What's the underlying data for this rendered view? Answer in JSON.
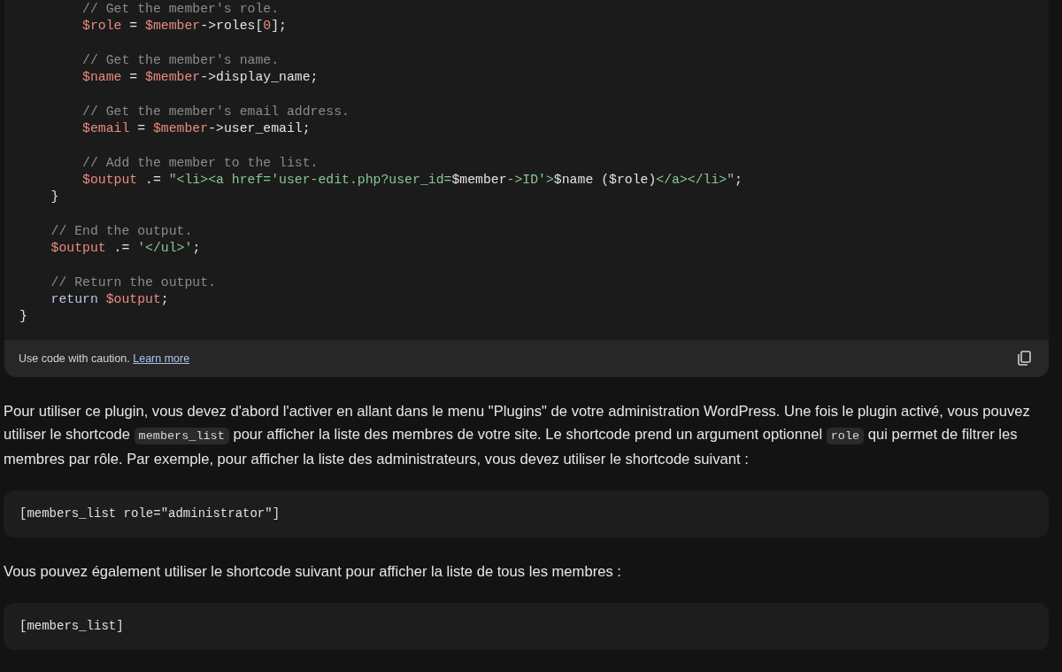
{
  "code_block": {
    "lines": [
      {
        "kind": "code",
        "tokens": [
          {
            "kind": "comment",
            "text": "        // Get the member's role."
          }
        ]
      },
      {
        "kind": "code",
        "tokens": [
          {
            "kind": "variable",
            "text": "        $role"
          },
          {
            "kind": "plain",
            "text": " = "
          },
          {
            "kind": "variable",
            "text": "$member"
          },
          {
            "kind": "plain",
            "text": "->roles["
          },
          {
            "kind": "number",
            "text": "0"
          },
          {
            "kind": "plain",
            "text": "];"
          }
        ]
      },
      {
        "kind": "blank"
      },
      {
        "kind": "code",
        "tokens": [
          {
            "kind": "comment",
            "text": "        // Get the member's name."
          }
        ]
      },
      {
        "kind": "code",
        "tokens": [
          {
            "kind": "variable",
            "text": "        $name"
          },
          {
            "kind": "plain",
            "text": " = "
          },
          {
            "kind": "variable",
            "text": "$member"
          },
          {
            "kind": "plain",
            "text": "->display_name;"
          }
        ]
      },
      {
        "kind": "blank"
      },
      {
        "kind": "code",
        "tokens": [
          {
            "kind": "comment",
            "text": "        // Get the member's email address."
          }
        ]
      },
      {
        "kind": "code",
        "tokens": [
          {
            "kind": "variable",
            "text": "        $email"
          },
          {
            "kind": "plain",
            "text": " = "
          },
          {
            "kind": "variable",
            "text": "$member"
          },
          {
            "kind": "plain",
            "text": "->user_email;"
          }
        ]
      },
      {
        "kind": "blank"
      },
      {
        "kind": "code",
        "tokens": [
          {
            "kind": "comment",
            "text": "        // Add the member to the list."
          }
        ]
      },
      {
        "kind": "code",
        "tokens": [
          {
            "kind": "variable",
            "text": "        $output"
          },
          {
            "kind": "plain",
            "text": " .= "
          },
          {
            "kind": "string",
            "text": "\"<li><a href='user-edit.php?user_id="
          },
          {
            "kind": "plain",
            "text": "$member"
          },
          {
            "kind": "string",
            "text": "->ID'>"
          },
          {
            "kind": "plain",
            "text": "$name ($role)"
          },
          {
            "kind": "string",
            "text": "</a></li>\""
          },
          {
            "kind": "plain",
            "text": ";"
          }
        ]
      },
      {
        "kind": "code",
        "tokens": [
          {
            "kind": "plain",
            "text": "    }"
          }
        ]
      },
      {
        "kind": "blank"
      },
      {
        "kind": "code",
        "tokens": [
          {
            "kind": "comment",
            "text": "    // End the output."
          }
        ]
      },
      {
        "kind": "code",
        "tokens": [
          {
            "kind": "variable",
            "text": "    $output"
          },
          {
            "kind": "plain",
            "text": " .= "
          },
          {
            "kind": "string",
            "text": "'</ul>'"
          },
          {
            "kind": "plain",
            "text": ";"
          }
        ]
      },
      {
        "kind": "blank"
      },
      {
        "kind": "code",
        "tokens": [
          {
            "kind": "comment",
            "text": "    // Return the output."
          }
        ]
      },
      {
        "kind": "code",
        "tokens": [
          {
            "kind": "keyword",
            "text": "    return "
          },
          {
            "kind": "variable",
            "text": "$output"
          },
          {
            "kind": "plain",
            "text": ";"
          }
        ]
      },
      {
        "kind": "code",
        "tokens": [
          {
            "kind": "plain",
            "text": "}"
          }
        ]
      }
    ],
    "footer": {
      "notice": "Use code with caution.",
      "link": "Learn more"
    }
  },
  "content": [
    {
      "kind": "paragraph",
      "segments": [
        {
          "kind": "text",
          "text": "Pour utiliser ce plugin, vous devez d'abord l'activer en allant dans le menu \"Plugins\" de votre administration WordPress. Une fois le plugin activé, vous pouvez utiliser le shortcode "
        },
        {
          "kind": "code",
          "text": "members_list"
        },
        {
          "kind": "text",
          "text": " pour afficher la liste des membres de votre site. Le shortcode prend un argument optionnel "
        },
        {
          "kind": "code",
          "text": "role"
        },
        {
          "kind": "text",
          "text": " qui permet de filtrer les membres par rôle. Par exemple, pour afficher la liste des administrateurs, vous devez utiliser le shortcode suivant :"
        }
      ]
    },
    {
      "kind": "snippet",
      "text": "[members_list role=\"administrator\"]"
    },
    {
      "kind": "paragraph",
      "segments": [
        {
          "kind": "text",
          "text": "Vous pouvez également utiliser le shortcode suivant pour afficher la liste de tous les membres :"
        }
      ]
    },
    {
      "kind": "snippet",
      "text": "[members_list]"
    }
  ]
}
